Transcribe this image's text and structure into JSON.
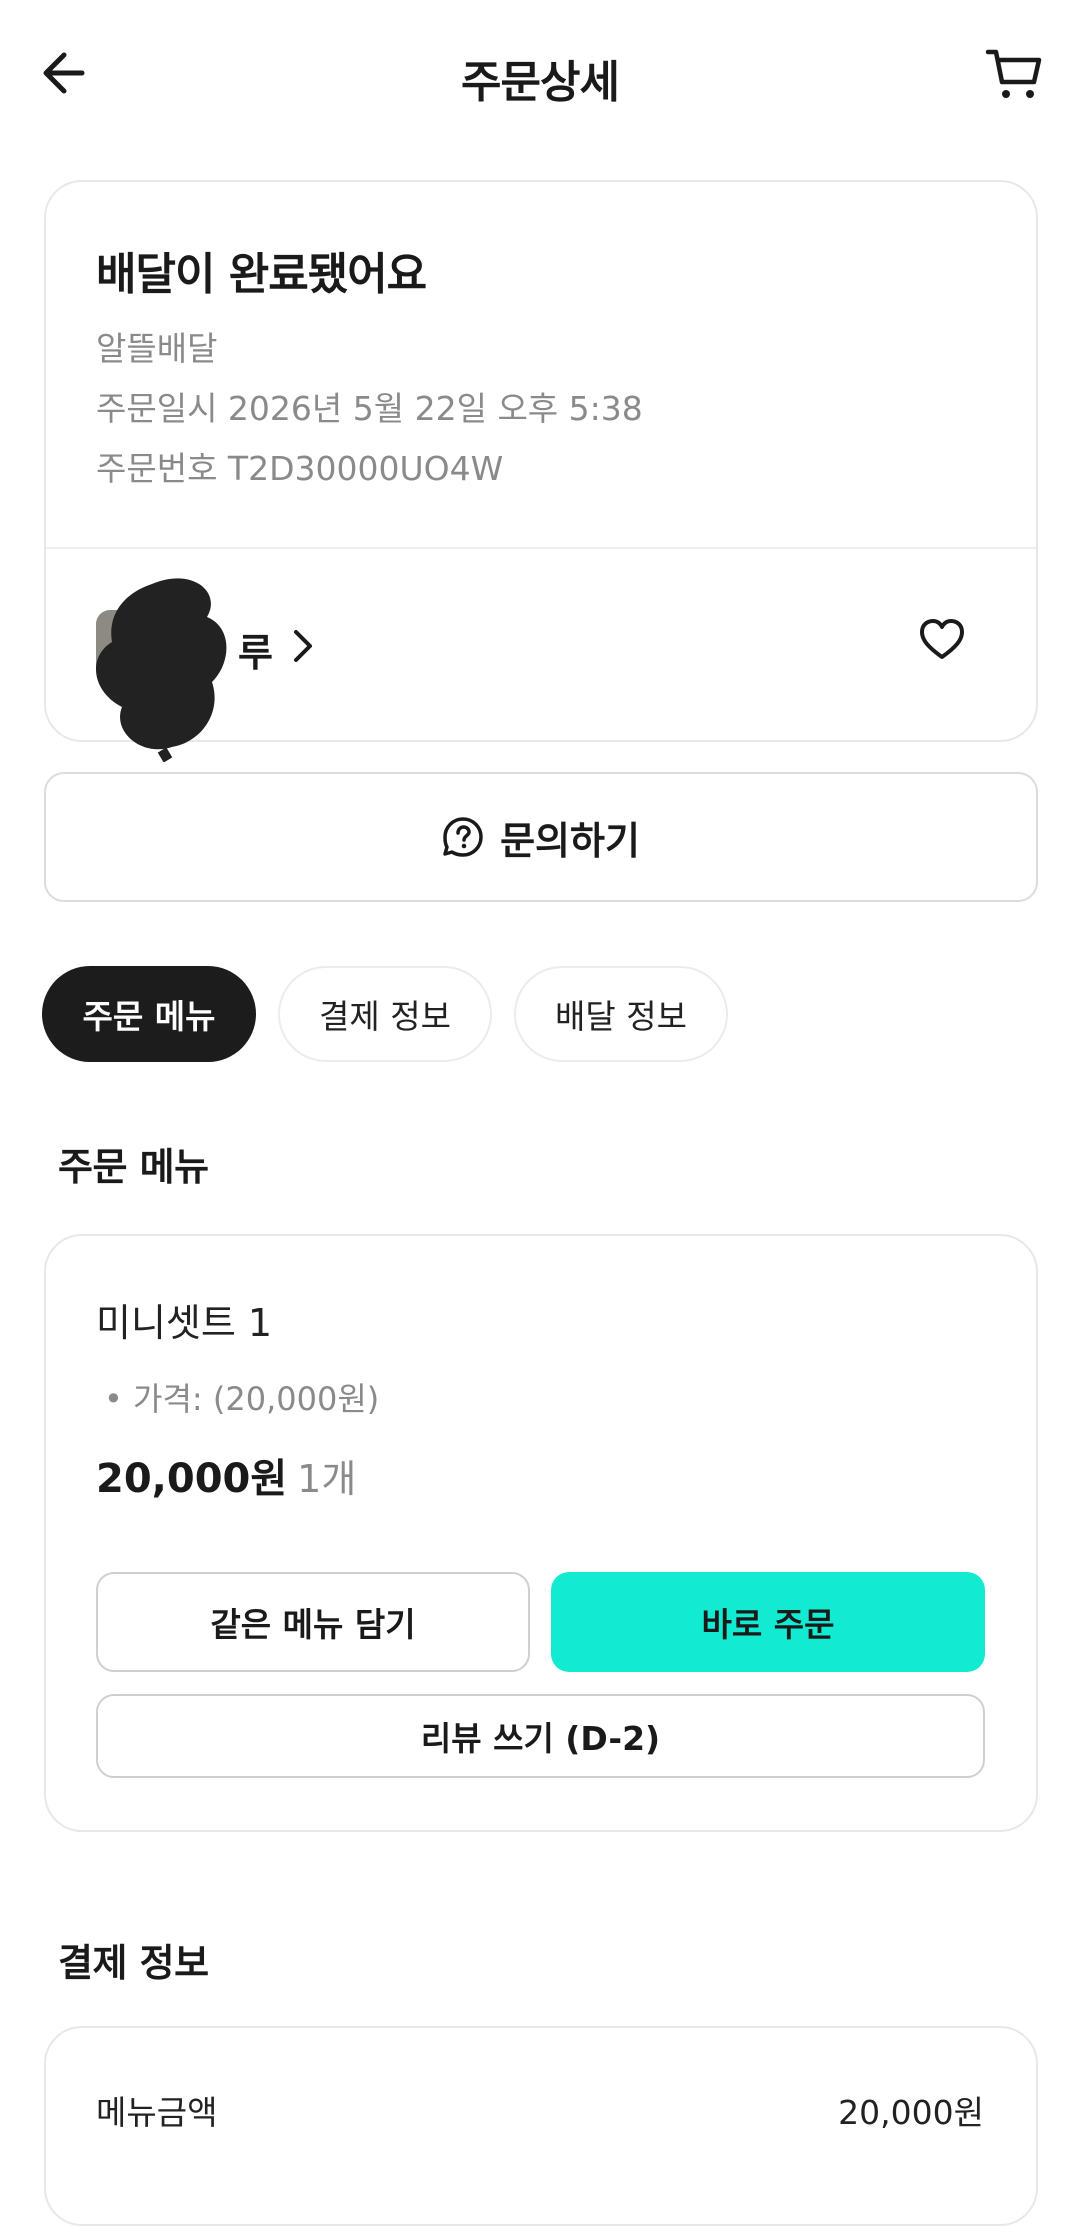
{
  "header": {
    "title": "주문상세",
    "back_icon": "arrow-left-icon",
    "cart_icon": "cart-icon"
  },
  "status": {
    "title": "배달이 완료됐어요",
    "delivery_type": "알뜰배달",
    "order_datetime": "주문일시 2026년 5월 22일 오후 5:38",
    "order_number": "주문번호 T2D30000UO4W"
  },
  "store": {
    "name_visible": "루",
    "chevron_icon": "chevron-right-icon",
    "favorite_icon": "heart-outline-icon"
  },
  "inquiry": {
    "label": "문의하기",
    "icon": "question-bubble-icon"
  },
  "tabs": [
    {
      "label": "주문 메뉴",
      "active": true
    },
    {
      "label": "결제 정보",
      "active": false
    },
    {
      "label": "배달 정보",
      "active": false
    }
  ],
  "order_menu": {
    "section_title": "주문 메뉴",
    "item": {
      "name": "미니셋트 1",
      "option": "• 가격:  (20,000원)",
      "price": "20,000원",
      "quantity": "1개"
    },
    "buttons": {
      "add_same": "같은 메뉴 담기",
      "order_now": "바로 주문",
      "write_review": "리뷰 쓰기 (D-2)"
    }
  },
  "payment": {
    "section_title": "결제 정보",
    "rows": [
      {
        "label": "메뉴금액",
        "value": "20,000원"
      }
    ]
  },
  "colors": {
    "accent_mint": "#12ebd1",
    "chip_active": "#1c1c1c"
  }
}
